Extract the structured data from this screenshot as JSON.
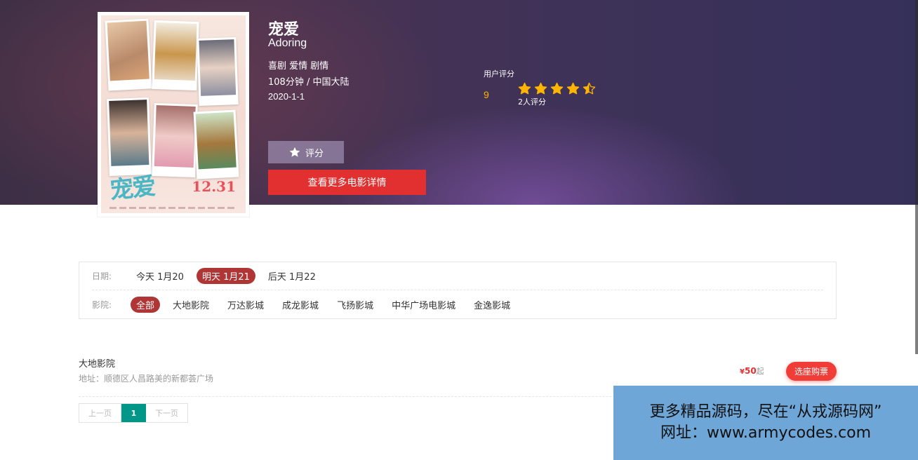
{
  "movie": {
    "title": "宠爱",
    "english_title": "Adoring",
    "genres": "喜剧 爱情 剧情",
    "meta": "108分钟 / 中国大陆",
    "release_date": "2020-1-1",
    "poster": {
      "title": "宠爱",
      "date": "12.31"
    }
  },
  "rating": {
    "label": "用户评分",
    "score": "9",
    "stars": 4.5,
    "stars_max": 5,
    "count": "2人评分",
    "color": "#ffb400"
  },
  "actions": {
    "rate_label": "评分",
    "rate_icon": "star-icon",
    "details_label": "查看更多电影详情",
    "details_color": "#e23030"
  },
  "filters": {
    "date_label": "日期:",
    "dates": [
      "今天 1月20",
      "明天 1月21",
      "后天 1月22"
    ],
    "active_date": 1,
    "cinema_label": "影院:",
    "cinemas": [
      "全部",
      "大地影院",
      "万达影城",
      "成龙影城",
      "飞扬影城",
      "中华广场电影城",
      "金逸影城"
    ],
    "active_cinema": 0,
    "active_color": "#b03636"
  },
  "cinema_list": [
    {
      "name": "大地影院",
      "address": "地址：顺德区人昌路美的新都荟广场",
      "price_symbol": "¥",
      "price": "50",
      "price_suffix": "起",
      "buy_label": "选座购票"
    }
  ],
  "pagination": {
    "prev": "上一页",
    "current": "1",
    "next": "下一页",
    "accent": "#009688"
  },
  "watermark": {
    "line1": "更多精品源码，尽在“从戎源码网”",
    "line2": "网址：www.armycodes.com"
  }
}
